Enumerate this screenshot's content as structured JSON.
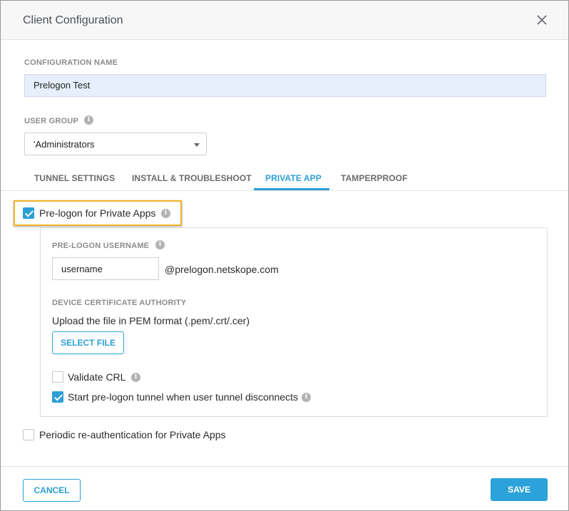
{
  "dialog": {
    "title": "Client Configuration",
    "close_icon": "close-icon"
  },
  "config_name": {
    "label": "CONFIGURATION NAME",
    "value": "Prelogon Test"
  },
  "user_group": {
    "label": "USER GROUP",
    "info_icon": "info-icon",
    "selected": "'Administrators"
  },
  "tabs": [
    {
      "label": "TUNNEL SETTINGS",
      "active": false
    },
    {
      "label": "INSTALL & TROUBLESHOOT",
      "active": false
    },
    {
      "label": "PRIVATE APP",
      "active": true
    },
    {
      "label": "TAMPERPROOF",
      "active": false
    }
  ],
  "private_app": {
    "prelogon": {
      "label": "Pre-logon for Private Apps",
      "checked": true,
      "info_icon": "info-icon"
    },
    "username": {
      "label": "PRE-LOGON USERNAME",
      "value": "username",
      "suffix": "@prelogon.netskope.com",
      "info_icon": "info-icon"
    },
    "certificate": {
      "label": "DEVICE CERTIFICATE AUTHORITY",
      "hint": "Upload the file in PEM format (.pem/.crt/.cer)",
      "select_button": "SELECT FILE"
    },
    "validate_crl": {
      "label": "Validate CRL",
      "checked": false,
      "info_icon": "info-icon"
    },
    "start_tunnel": {
      "label": "Start pre-logon tunnel when user tunnel disconnects",
      "checked": true,
      "info_icon": "info-icon"
    },
    "periodic_reauth": {
      "label": "Periodic re-authentication for Private Apps",
      "checked": false
    }
  },
  "footer": {
    "cancel_label": "CANCEL",
    "save_label": "SAVE"
  },
  "colors": {
    "accent": "#2c9fd6",
    "highlight": "#f0b226",
    "input_fill": "#e6effb"
  }
}
